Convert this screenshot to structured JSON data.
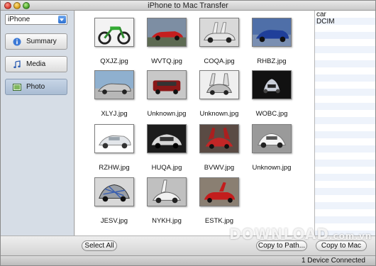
{
  "window": {
    "title": "iPhone to Mac Transfer"
  },
  "sidebar": {
    "device_select": {
      "value": "iPhone"
    },
    "items": [
      {
        "label": "Summary",
        "icon": "info-icon"
      },
      {
        "label": "Media",
        "icon": "music-note-icon"
      },
      {
        "label": "Photo",
        "icon": "photo-icon",
        "active": true
      }
    ]
  },
  "photos": [
    {
      "name": "QXJZ.jpg"
    },
    {
      "name": "WVTQ.jpg"
    },
    {
      "name": "COQA.jpg"
    },
    {
      "name": "RHBZ.jpg"
    },
    {
      "name": "XLYJ.jpg"
    },
    {
      "name": "Unknown.jpg"
    },
    {
      "name": "Unknown.jpg"
    },
    {
      "name": "WOBC.jpg"
    },
    {
      "name": "RZHW.jpg"
    },
    {
      "name": "HUQA.jpg"
    },
    {
      "name": "BVWV.jpg"
    },
    {
      "name": "Unknown.jpg"
    },
    {
      "name": "JESV.jpg"
    },
    {
      "name": "NYKH.jpg"
    },
    {
      "name": "ESTK.jpg"
    }
  ],
  "folders": [
    "car",
    "DCIM"
  ],
  "buttons": {
    "select_all": "Select All",
    "copy_to_path": "Copy to Path...",
    "copy_to_mac": "Copy to Mac"
  },
  "status": {
    "text": "1 Device Connected"
  },
  "watermark": {
    "text": "DOWNLOAD",
    "sub": ".com.vn"
  },
  "colors": {
    "accent": "#2c6fd0",
    "sidebar_bg": "#d6dde6",
    "selected_nav": "#b6c6da"
  }
}
